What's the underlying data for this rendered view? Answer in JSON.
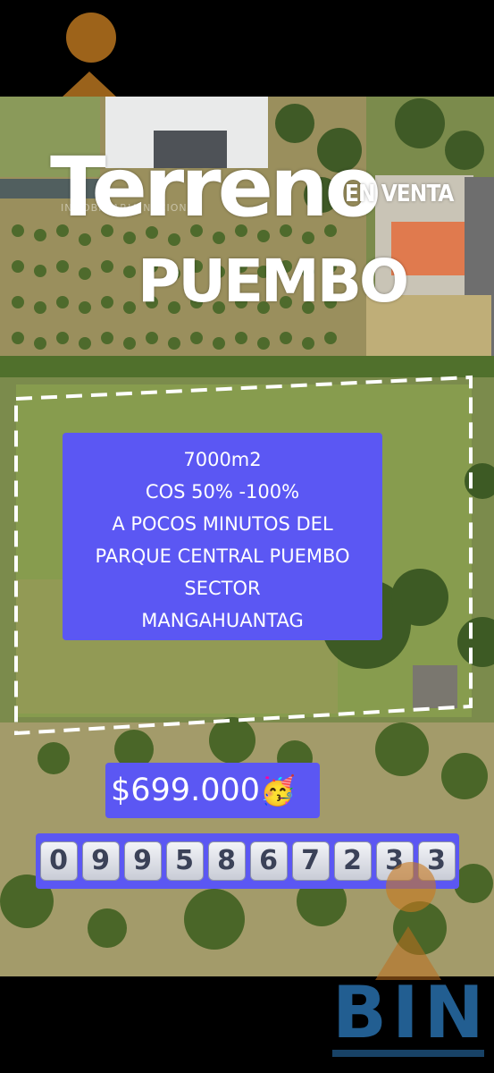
{
  "headline": {
    "main": "Terreno",
    "tag": "EN VENTA",
    "place": "PUEMBO"
  },
  "watermark": "INMOBILIARIA NACIONAL",
  "details": {
    "lines": [
      "7000m2",
      "COS 50% -100%",
      "A POCOS MINUTOS DEL",
      "PARQUE CENTRAL PUEMBO",
      "SECTOR",
      "MANGAHUANTAG"
    ]
  },
  "price": {
    "value": "$699.000",
    "emoji": "🥳"
  },
  "phone": {
    "digits": [
      "0",
      "9",
      "9",
      "5",
      "8",
      "6",
      "7",
      "2",
      "3",
      "3"
    ]
  },
  "brand": {
    "logo_text": "BIN"
  },
  "colors": {
    "accent": "#5b57f3",
    "boundary": "#ffffff"
  }
}
